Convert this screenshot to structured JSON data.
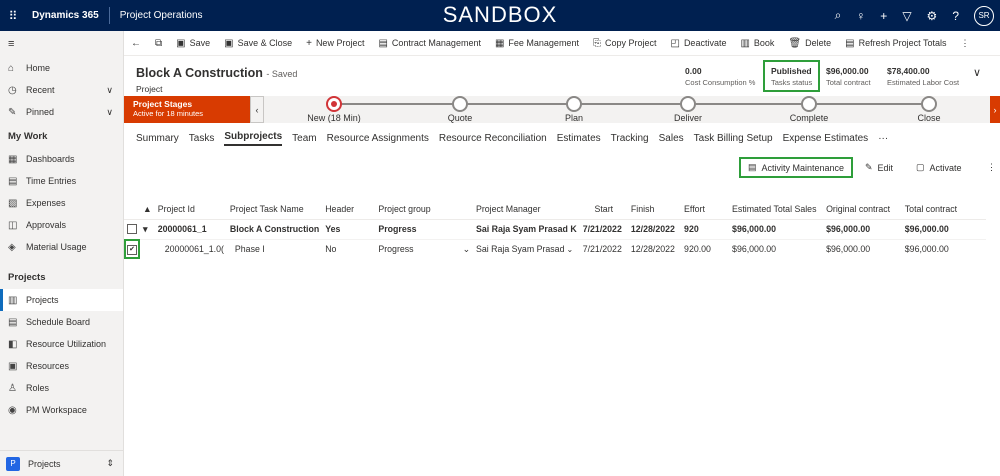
{
  "topbar": {
    "brand": "Dynamics 365",
    "app": "Project Operations",
    "banner": "SANDBOX",
    "avatar": "SR",
    "icons": [
      "waffle-icon",
      "search-icon",
      "lightbulb-icon",
      "plus-icon",
      "filter-icon",
      "gear-icon",
      "help-icon"
    ]
  },
  "sidebar": {
    "items_top": [
      {
        "label": "Home",
        "icon": "⌂"
      },
      {
        "label": "Recent",
        "icon": "◷"
      },
      {
        "label": "Pinned",
        "icon": "✎"
      }
    ],
    "section_work": "My Work",
    "work": [
      {
        "label": "Dashboards",
        "icon": "▦"
      },
      {
        "label": "Time Entries",
        "icon": "▤"
      },
      {
        "label": "Expenses",
        "icon": "▧"
      },
      {
        "label": "Approvals",
        "icon": "◫"
      },
      {
        "label": "Material Usage",
        "icon": "◈"
      }
    ],
    "section_projects": "Projects",
    "projects": [
      {
        "label": "Projects",
        "icon": "▥"
      },
      {
        "label": "Schedule Board",
        "icon": "▤"
      },
      {
        "label": "Resource Utilization",
        "icon": "◧"
      },
      {
        "label": "Resources",
        "icon": "▣"
      },
      {
        "label": "Roles",
        "icon": "♙"
      },
      {
        "label": "PM Workspace",
        "icon": "◉"
      }
    ],
    "area": "Projects",
    "area_letter": "P"
  },
  "commands": [
    "Save",
    "Save & Close",
    "New Project",
    "Contract Management",
    "Fee Management",
    "Copy Project",
    "Deactivate",
    "Book",
    "Delete",
    "Refresh Project Totals"
  ],
  "record": {
    "title": "Block A Construction",
    "saved": "- Saved",
    "entity": "Project"
  },
  "kpis": [
    {
      "value": "0.00",
      "label": "Cost Consumption %"
    },
    {
      "value": "Published",
      "label": "Tasks status"
    },
    {
      "value": "$96,000.00",
      "label": "Total contract"
    },
    {
      "value": "$78,400.00",
      "label": "Estimated Labor Cost"
    }
  ],
  "bpf": {
    "title": "Project Stages",
    "sub": "Active for 18 minutes",
    "stages": [
      "New  (18 Min)",
      "Quote",
      "Plan",
      "Deliver",
      "Complete",
      "Close"
    ]
  },
  "tabs": [
    "Summary",
    "Tasks",
    "Subprojects",
    "Team",
    "Resource Assignments",
    "Resource Reconciliation",
    "Estimates",
    "Tracking",
    "Sales",
    "Task Billing Setup",
    "Expense Estimates",
    "···"
  ],
  "gridcmd": {
    "activity": "Activity Maintenance",
    "edit": "Edit",
    "activate": "Activate"
  },
  "grid": {
    "headers": [
      "Project Id",
      "Project Task Name",
      "Header",
      "Project group",
      "Project Manager",
      "Start",
      "Finish",
      "Effort",
      "Estimated Total Sales",
      "Original contract",
      "Total contract"
    ],
    "rows": [
      [
        "20000061_1",
        "Block A Construction",
        "Yes",
        "Progress",
        "Sai Raja Syam Prasad K",
        "7/21/2022",
        "12/28/2022",
        "920",
        "$96,000.00",
        "$96,000.00",
        "$96,000.00"
      ],
      [
        "20000061_1.0(",
        "Phase I",
        "No",
        "Progress",
        "Sai Raja Syam Prasad",
        "7/21/2022",
        "12/28/2022",
        "920.00",
        "$96,000.00",
        "$96,000.00",
        "$96,000.00"
      ]
    ]
  }
}
